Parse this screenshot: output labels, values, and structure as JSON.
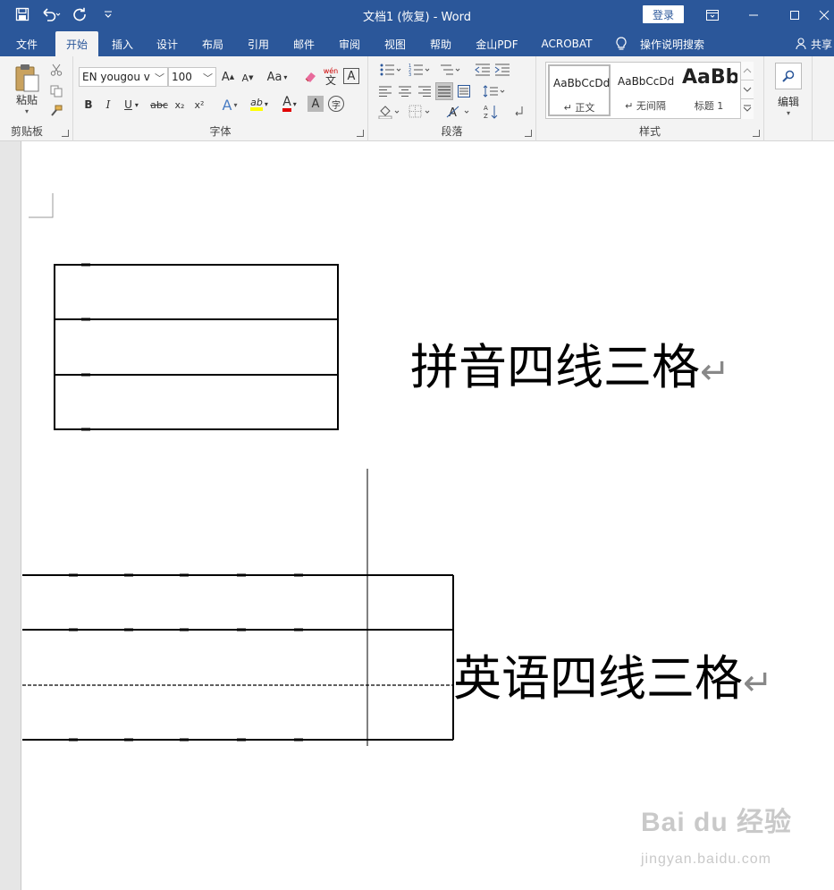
{
  "title": {
    "doc_title": "文档1 (恢复)  -  Word",
    "login_label": "登录"
  },
  "tabs": [
    "文件",
    "开始",
    "插入",
    "设计",
    "布局",
    "引用",
    "邮件",
    "审阅",
    "视图",
    "帮助",
    "金山PDF",
    "ACROBAT"
  ],
  "tell_me": "操作说明搜索",
  "share": "共享",
  "ribbon": {
    "clipboard": {
      "paste_label": "粘贴",
      "group_label": "剪贴板"
    },
    "font": {
      "font_name": "EN yougou v",
      "font_size": "100",
      "case_label": "Aa",
      "pinyin_top": "wén",
      "pinyin_char": "文",
      "border_char": "A",
      "bold": "B",
      "italic": "I",
      "underline": "U",
      "strike": "abc",
      "sub": "x₂",
      "sup": "x²",
      "effects": "A",
      "highlight": "ab",
      "font_color": "A",
      "shading": "A",
      "circle": "字",
      "group_label": "字体",
      "grow": "A",
      "shrink": "A"
    },
    "paragraph": {
      "group_label": "段落"
    },
    "styles": {
      "group_label": "样式",
      "items": [
        {
          "preview": "AaBbCcDd",
          "name": "↵ 正文"
        },
        {
          "preview": "AaBbCcDd",
          "name": "↵ 无间隔"
        },
        {
          "preview": "AaBb",
          "name": "标题 1"
        }
      ]
    },
    "editing": {
      "label": "编辑"
    }
  },
  "document": {
    "pinyin_caption": "拼音四线三格",
    "english_caption": "英语四线三格",
    "para_mark": "↵"
  },
  "watermark": {
    "logo": "Bai du 经验",
    "url": "jingyan.baidu.com"
  },
  "colors": {
    "title_bar": "#2b579a",
    "ribbon_bg": "#f3f3f3",
    "highlight_yellow": "#ffff00",
    "font_red": "#e00000"
  }
}
